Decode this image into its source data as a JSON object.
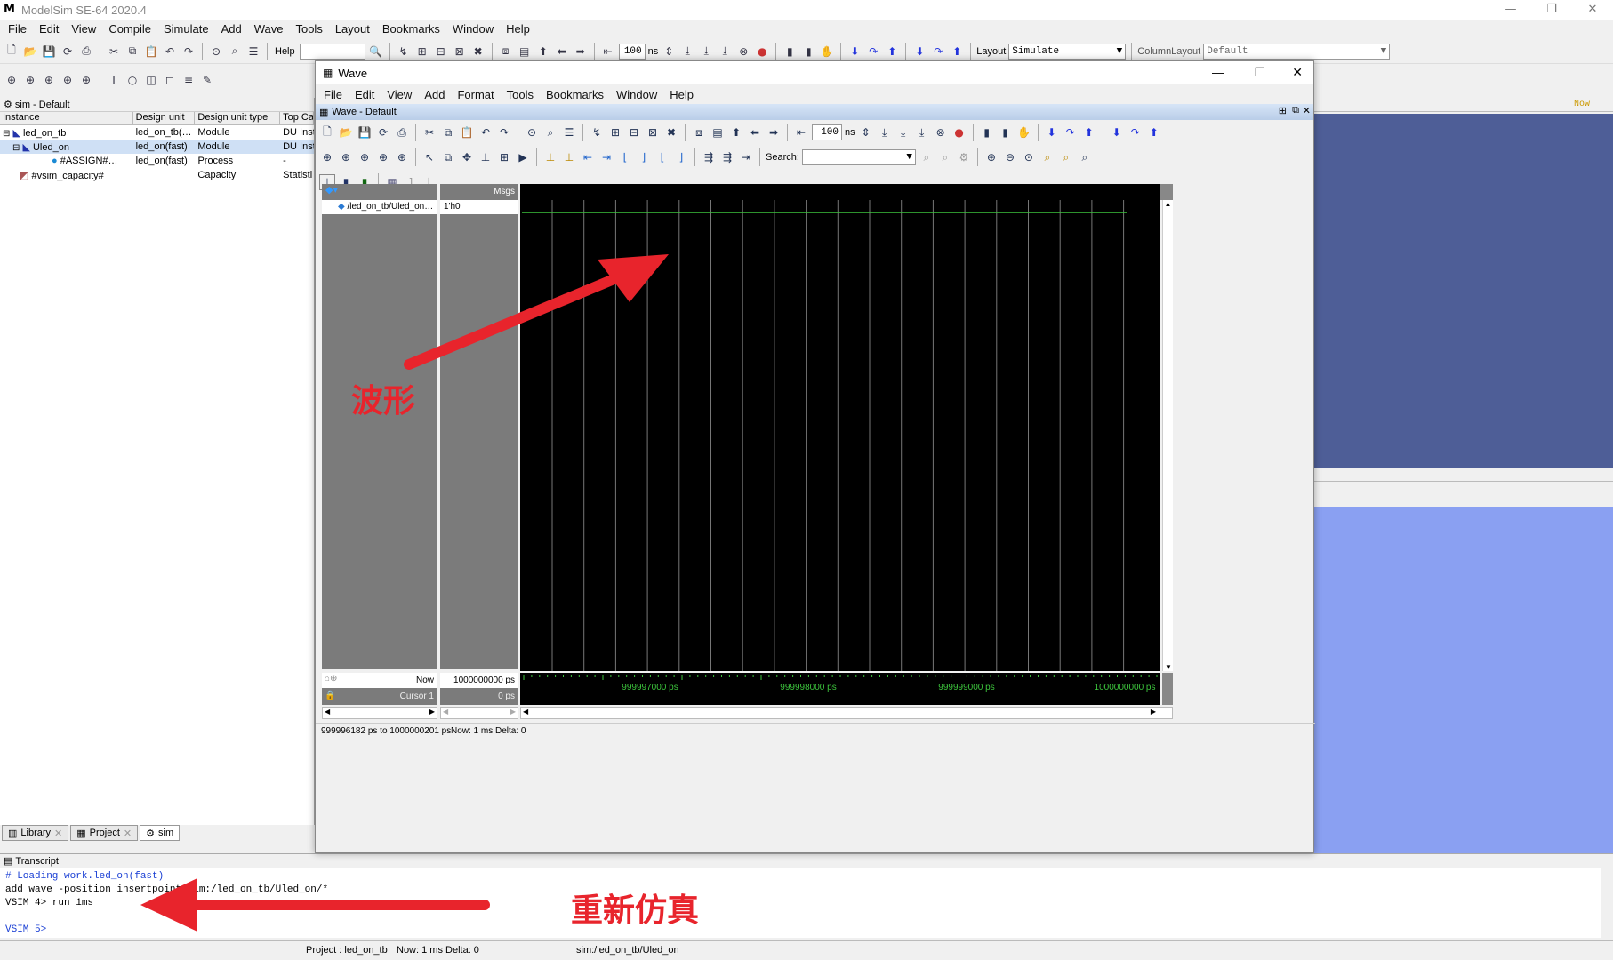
{
  "app": {
    "title": "ModelSim SE-64 2020.4"
  },
  "main_menu": [
    "File",
    "Edit",
    "View",
    "Compile",
    "Simulate",
    "Add",
    "Wave",
    "Tools",
    "Layout",
    "Bookmarks",
    "Window",
    "Help"
  ],
  "toolbar": {
    "help_label": "Help",
    "time_value": "100",
    "time_unit": "ns",
    "layout_label": "Layout",
    "layout_value": "Simulate",
    "column_layout_label": "ColumnLayout",
    "column_layout_value": "Default",
    "now_label": "Now"
  },
  "sim_pane": {
    "title": "sim - Default",
    "columns": [
      "Instance",
      "Design unit",
      "Design unit type",
      "Top Ca"
    ],
    "rows": [
      {
        "instance": "led_on_tb",
        "unit": "led_on_tb(…",
        "type": "Module",
        "top": "DU Inst"
      },
      {
        "instance": "Uled_on",
        "unit": "led_on(fast)",
        "type": "Module",
        "top": "DU Inst"
      },
      {
        "instance": "#ASSIGN#…",
        "unit": "led_on(fast)",
        "type": "Process",
        "top": "-"
      },
      {
        "instance": "#vsim_capacity#",
        "unit": "",
        "type": "Capacity",
        "top": "Statisti"
      }
    ]
  },
  "tabs": [
    "Library",
    "Project",
    "sim"
  ],
  "transcript": {
    "title": "Transcript",
    "lines": [
      "# Loading work.led_on(fast)",
      "add wave -position insertpoint  sim:/led_on_tb/Uled_on/*",
      "VSIM 4> run 1ms",
      "",
      "VSIM 5>"
    ]
  },
  "statusbar": {
    "project": "Project : led_on_tb",
    "now": "Now: 1 ms  Delta: 0",
    "path": "sim:/led_on_tb/Uled_on"
  },
  "wave_window": {
    "title": "Wave",
    "menu": [
      "File",
      "Edit",
      "View",
      "Add",
      "Format",
      "Tools",
      "Bookmarks",
      "Window",
      "Help"
    ],
    "inner_title": "Wave - Default",
    "search_label": "Search:",
    "msgs_header": "Msgs",
    "signal_name": "/led_on_tb/Uled_on…",
    "signal_value": "1'h0",
    "now_label": "Now",
    "now_value": "1000000000 ps",
    "cursor_label": "Cursor 1",
    "cursor_value": "0 ps",
    "time_ticks": [
      "999997000 ps",
      "999998000 ps",
      "999999000 ps",
      "1000000000 ps"
    ],
    "status_range": "999996182 ps to 1000000201 ps",
    "status_now": "Now: 1 ms   Delta: 0"
  },
  "annotations": {
    "wave_label": "波形",
    "resim_label": "重新仿真",
    "arrow_color": "#e8242c"
  },
  "colors": {
    "wave_bg": "#000000",
    "signal_green": "#3cc43c",
    "grid": "#777777",
    "right_blue_top": "#4e5e97",
    "right_blue_bottom": "#8aa0f2"
  }
}
